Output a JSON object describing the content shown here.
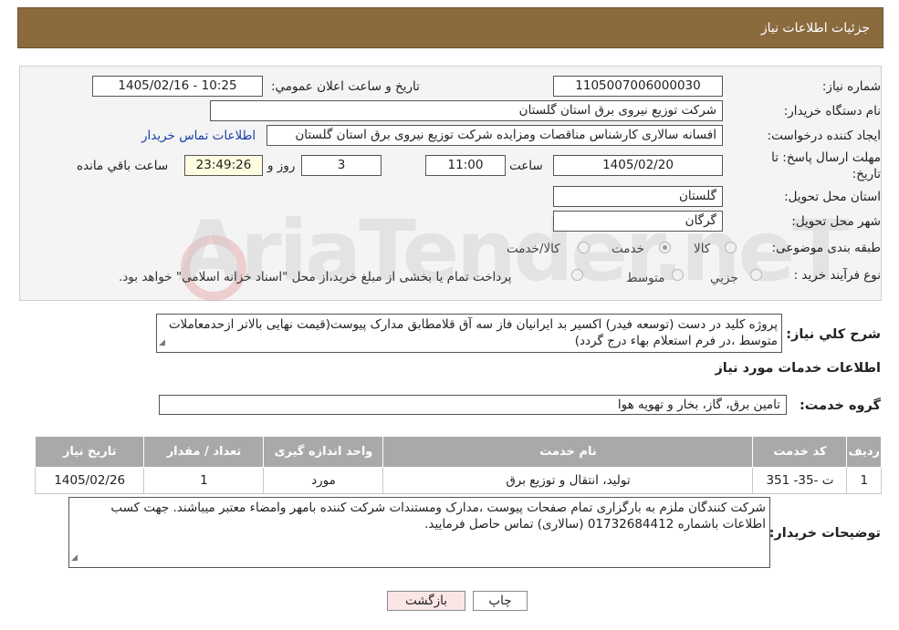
{
  "header": {
    "title": "جزئیات اطلاعات نیاز"
  },
  "form": {
    "need_number_label": "شماره نیاز:",
    "need_number": "1105007006000030",
    "announce_label": "تاریخ و ساعت اعلان عمومي:",
    "announce_value": "1405/02/16 - 10:25",
    "buyer_org_label": "نام دستگاه خریدار:",
    "buyer_org": "شرکت توزیع نیروی برق استان گلستان",
    "creator_label": "ایجاد کننده درخواست:",
    "creator": "افسانه سالاری کارشناس مناقصات ومزایده شرکت توزیع نیروی برق استان گلستان",
    "contact_link": "اطلاعات تماس خریدار",
    "deadline_label_1": "مهلت ارسال پاسخ: تا",
    "deadline_label_2": "تاریخ:",
    "deadline_date": "1405/02/20",
    "time_label": "ساعت",
    "deadline_time": "11:00",
    "days_value": "3",
    "days_label": "روز و",
    "remaining_time": "23:49:26",
    "remaining_label": "ساعت باقي مانده",
    "province_label": "استان محل تحویل:",
    "province": "گلستان",
    "city_label": "شهر محل تحویل:",
    "city": "گرگان",
    "category_label": "طبقه بندی موضوعی:",
    "category_options": [
      "کالا",
      "خدمت",
      "کالا/خدمت"
    ],
    "category_selected": "خدمت",
    "process_label": "نوع فرآیند خرید :",
    "process_options": [
      "جزیي",
      "متوسط"
    ],
    "process_note": "پرداخت تمام یا بخشی از مبلغ خرید،از محل \"اسناد خزانه اسلامی\" خواهد بود."
  },
  "watermark": {
    "text": "AriaTender.neT"
  },
  "summary": {
    "label": "شرح کلي نیاز:",
    "text": "پروژه کلید در دست (توسعه فیدر) اکسیر بد ایرانیان فاز سه آق قلامطابق مدارک پیوست(قیمت نهایی بالاتر ازحدمعاملات متوسط ،در فرم استعلام بهاء درج گردد)"
  },
  "services": {
    "section_title": "اطلاعات خدمات مورد نیاز",
    "group_label": "گروه خدمت:",
    "group_value": "تامین برق، گاز، بخار و تهویه هوا",
    "columns": [
      "ردیف",
      "کد خدمت",
      "نام خدمت",
      "واحد اندازه گیری",
      "تعداد / مقدار",
      "تاریخ نیاز"
    ],
    "rows": [
      [
        "1",
        "ت -35- 351",
        "تولید، انتقال و توزیع برق",
        "مورد",
        "1",
        "1405/02/26"
      ]
    ]
  },
  "buyer_notes": {
    "label": "توضیحات خریدار:",
    "text": "شرکت کنندگان ملزم به بارگزاری تمام صفحات پیوست ،مدارک ومستندات شرکت کننده بامهر وامضاء معتبر میباشند. جهت کسب اطلاعات باشماره 01732684412 (سالاری) تماس حاصل فرمایید."
  },
  "buttons": {
    "print": "چاپ",
    "back": "بازگشت"
  },
  "colors": {
    "header_bg": "#8b6a3e",
    "link": "#1a3fa8",
    "back_button_bg": "#fbe6e6",
    "print_button_bg": "#ffffff"
  }
}
